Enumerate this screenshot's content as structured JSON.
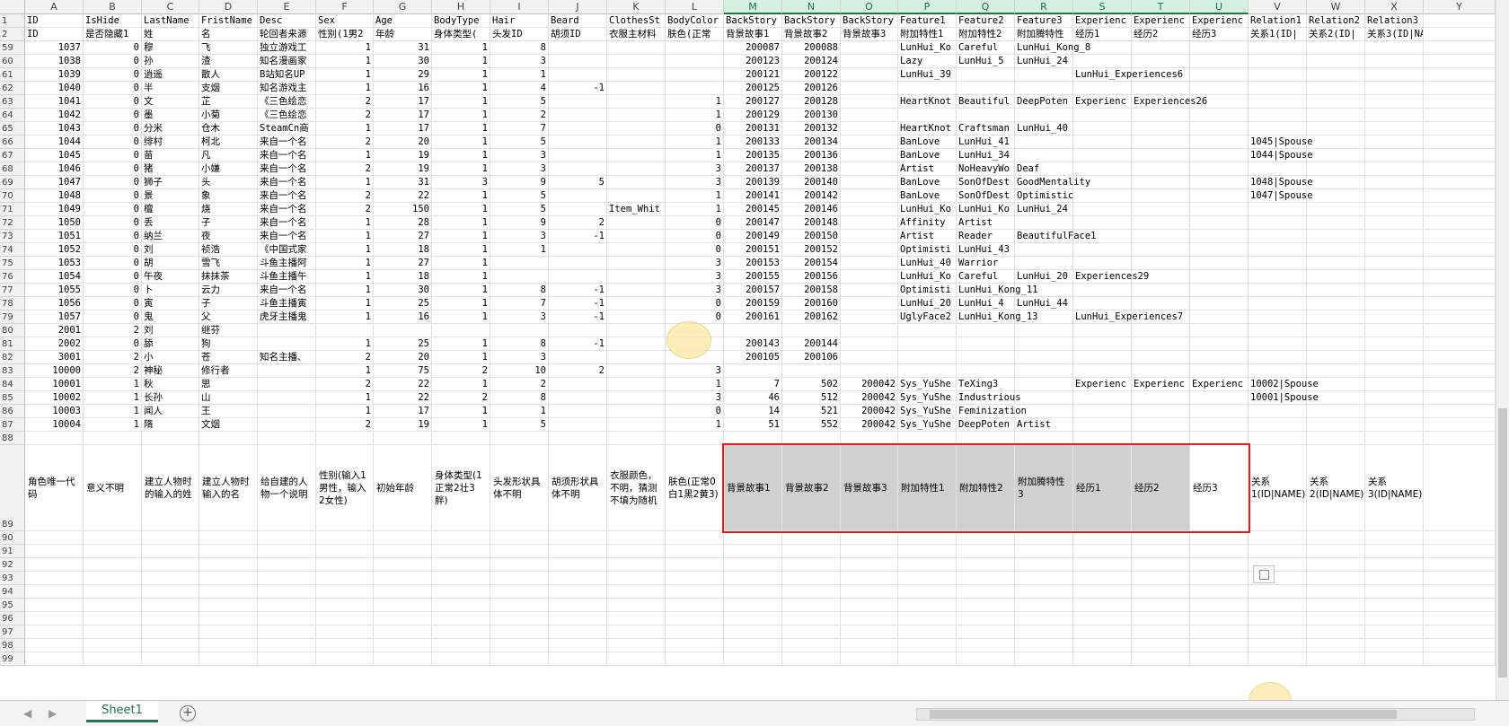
{
  "columns": [
    "A",
    "B",
    "C",
    "D",
    "E",
    "F",
    "G",
    "H",
    "I",
    "J",
    "K",
    "L",
    "M",
    "N",
    "O",
    "P",
    "Q",
    "R",
    "S",
    "T",
    "U",
    "V",
    "W",
    "X",
    "Y"
  ],
  "selected_columns": [
    "M",
    "N",
    "O",
    "P",
    "Q",
    "R",
    "S",
    "T",
    "U"
  ],
  "header_rows": [
    {
      "num": "1",
      "cells": [
        "ID",
        "IsHide",
        "LastName",
        "FristName",
        "Desc",
        "Sex",
        "Age",
        "BodyType",
        "Hair",
        "Beard",
        "ClothesSt",
        "BodyColor",
        "BackStory",
        "BackStory",
        "BackStory",
        "Feature1",
        "Feature2",
        "Feature3",
        "Experienc",
        "Experienc",
        "Experienc",
        "Relation1",
        "Relation2",
        "Relation3",
        ""
      ]
    },
    {
      "num": "2",
      "cells": [
        "ID",
        "是否隐藏1",
        "姓",
        "名",
        "轮回者来源",
        "性别(1男2",
        "年龄",
        "身体类型(",
        "头发ID",
        "胡须ID",
        "衣服主材料",
        "肤色(正常",
        "背景故事1",
        "背景故事2",
        "背景故事3",
        "附加特性1",
        "附加特性2",
        "附加腾特性",
        "经历1",
        "经历2",
        "经历3",
        "关系1(ID|",
        "关系2(ID|",
        "关系3(ID|NAME)",
        ""
      ]
    }
  ],
  "rows": [
    {
      "num": "59",
      "cells": [
        "1037",
        "0",
        "穆",
        "飞",
        "独立游戏工",
        "1",
        "31",
        "1",
        "8",
        "",
        "",
        "",
        "200087",
        "200088",
        "",
        "LunHui_Ko",
        "Careful",
        "LunHui_Kong_8",
        "",
        "",
        "",
        "",
        "",
        "",
        ""
      ]
    },
    {
      "num": "60",
      "cells": [
        "1038",
        "0",
        "孙",
        "渣",
        "知名漫画家",
        "1",
        "30",
        "1",
        "3",
        "",
        "",
        "",
        "200123",
        "200124",
        "",
        "Lazy",
        "LunHui_5",
        "LunHui_24",
        "",
        "",
        "",
        "",
        "",
        "",
        ""
      ]
    },
    {
      "num": "61",
      "cells": [
        "1039",
        "0",
        "逍遥",
        "散人",
        "B站知名UP",
        "1",
        "29",
        "1",
        "1",
        "",
        "",
        "",
        "200121",
        "200122",
        "",
        "LunHui_39",
        "",
        "",
        "LunHui_Experiences6",
        "",
        "",
        "",
        "",
        "",
        ""
      ]
    },
    {
      "num": "62",
      "cells": [
        "1040",
        "0",
        "半",
        "支烟",
        "知名游戏主",
        "1",
        "16",
        "1",
        "4",
        "-1",
        "",
        "",
        "200125",
        "200126",
        "",
        "",
        "",
        "",
        "",
        "",
        "",
        "",
        "",
        "",
        ""
      ]
    },
    {
      "num": "63",
      "cells": [
        "1041",
        "0",
        "文",
        "芷",
        "《三色绘恋",
        "2",
        "17",
        "1",
        "5",
        "",
        "",
        "1",
        "200127",
        "200128",
        "",
        "HeartKnot",
        "Beautiful",
        "DeepPoten",
        "Experienc",
        "Experiences26",
        "",
        "",
        "",
        "",
        ""
      ]
    },
    {
      "num": "64",
      "cells": [
        "1042",
        "0",
        "墨",
        "小菊",
        "《三色绘恋",
        "2",
        "17",
        "1",
        "2",
        "",
        "",
        "1",
        "200129",
        "200130",
        "",
        "",
        "",
        "",
        "",
        "",
        "",
        "",
        "",
        "",
        ""
      ]
    },
    {
      "num": "65",
      "cells": [
        "1043",
        "0",
        "分米",
        "仓木",
        "SteamCn商",
        "1",
        "17",
        "1",
        "7",
        "",
        "",
        "0",
        "200131",
        "200132",
        "",
        "HeartKnot",
        "Craftsman",
        "LunHui_40",
        "",
        "",
        "",
        "",
        "",
        "",
        ""
      ]
    },
    {
      "num": "66",
      "cells": [
        "1044",
        "0",
        "绯村",
        "柯北",
        "来自一个名",
        "2",
        "20",
        "1",
        "5",
        "",
        "",
        "1",
        "200133",
        "200134",
        "",
        "BanLove",
        "LunHui_41",
        "",
        "",
        "",
        "",
        "1045|Spouse",
        "",
        "",
        ""
      ]
    },
    {
      "num": "67",
      "cells": [
        "1045",
        "0",
        "苗",
        "凡",
        "来自一个名",
        "1",
        "19",
        "1",
        "3",
        "",
        "",
        "1",
        "200135",
        "200136",
        "",
        "BanLove",
        "LunHui_34",
        "",
        "",
        "",
        "",
        "1044|Spouse",
        "",
        "",
        ""
      ]
    },
    {
      "num": "68",
      "cells": [
        "1046",
        "0",
        "猪",
        "小嫌",
        "来自一个名",
        "2",
        "19",
        "1",
        "3",
        "",
        "",
        "3",
        "200137",
        "200138",
        "",
        "Artist",
        "NoHeavyWo",
        "Deaf",
        "",
        "",
        "",
        "",
        "",
        "",
        ""
      ]
    },
    {
      "num": "69",
      "cells": [
        "1047",
        "0",
        "狮子",
        "头",
        "来自一个名",
        "1",
        "31",
        "3",
        "9",
        "5",
        "",
        "3",
        "200139",
        "200140",
        "",
        "BanLove",
        "SonOfDest",
        "GoodMentality",
        "",
        "",
        "",
        "1048|Spouse",
        "",
        "",
        ""
      ]
    },
    {
      "num": "70",
      "cells": [
        "1048",
        "0",
        "景",
        "象",
        "来自一个名",
        "2",
        "22",
        "1",
        "5",
        "",
        "",
        "1",
        "200141",
        "200142",
        "",
        "BanLove",
        "SonOfDest",
        "Optimistic",
        "",
        "",
        "",
        "1047|Spouse",
        "",
        "",
        ""
      ]
    },
    {
      "num": "71",
      "cells": [
        "1049",
        "0",
        "檀",
        "烧",
        "来自一个名",
        "2",
        "150",
        "1",
        "5",
        "",
        "Item_Whit",
        "1",
        "200145",
        "200146",
        "",
        "LunHui_Ko",
        "LunHui_Ko",
        "LunHui_24",
        "",
        "",
        "",
        "",
        "",
        "",
        ""
      ]
    },
    {
      "num": "72",
      "cells": [
        "1050",
        "0",
        "丢",
        "子",
        "来自一个名",
        "1",
        "28",
        "1",
        "9",
        "2",
        "",
        "0",
        "200147",
        "200148",
        "",
        "Affinity",
        "Artist",
        "",
        "",
        "",
        "",
        "",
        "",
        "",
        ""
      ]
    },
    {
      "num": "73",
      "cells": [
        "1051",
        "0",
        "纳兰",
        "夜",
        "来自一个名",
        "1",
        "27",
        "1",
        "3",
        "-1",
        "",
        "0",
        "200149",
        "200150",
        "",
        "Artist",
        "Reader",
        "BeautifulFace1",
        "",
        "",
        "",
        "",
        "",
        "",
        ""
      ]
    },
    {
      "num": "74",
      "cells": [
        "1052",
        "0",
        "刘",
        "祯浩",
        "《中国式家",
        "1",
        "18",
        "1",
        "1",
        "",
        "",
        "0",
        "200151",
        "200152",
        "",
        "Optimisti",
        "LunHui_43",
        "",
        "",
        "",
        "",
        "",
        "",
        "",
        ""
      ]
    },
    {
      "num": "75",
      "cells": [
        "1053",
        "0",
        "胡",
        "雪飞",
        "斗鱼主播阿",
        "1",
        "27",
        "1",
        "",
        "",
        "",
        "3",
        "200153",
        "200154",
        "",
        "LunHui_40",
        "Warrior",
        "",
        "",
        "",
        "",
        "",
        "",
        "",
        ""
      ]
    },
    {
      "num": "76",
      "cells": [
        "1054",
        "0",
        "午夜",
        "抹抹茶",
        "斗鱼主播午",
        "1",
        "18",
        "1",
        "",
        "",
        "",
        "3",
        "200155",
        "200156",
        "",
        "LunHui_Ko",
        "Careful",
        "LunHui_20",
        "Experiences29",
        "",
        "",
        "",
        "",
        "",
        ""
      ]
    },
    {
      "num": "77",
      "cells": [
        "1055",
        "0",
        "卜",
        "云力",
        "来自一个名",
        "1",
        "30",
        "1",
        "8",
        "-1",
        "",
        "3",
        "200157",
        "200158",
        "",
        "Optimisti",
        "LunHui_Kong_11",
        "",
        "",
        "",
        "",
        "",
        "",
        "",
        ""
      ]
    },
    {
      "num": "78",
      "cells": [
        "1056",
        "0",
        "寅",
        "子",
        "斗鱼主播寅",
        "1",
        "25",
        "1",
        "7",
        "-1",
        "",
        "0",
        "200159",
        "200160",
        "",
        "LunHui_20",
        "LunHui_4",
        "LunHui_44",
        "",
        "",
        "",
        "",
        "",
        "",
        ""
      ]
    },
    {
      "num": "79",
      "cells": [
        "1057",
        "0",
        "鬼",
        "父",
        "虎牙主播鬼",
        "1",
        "16",
        "1",
        "3",
        "-1",
        "",
        "0",
        "200161",
        "200162",
        "",
        "UglyFace2",
        "LunHui_Kong_13",
        "",
        "LunHui_Experiences7",
        "",
        "",
        "",
        "",
        "",
        ""
      ]
    },
    {
      "num": "80",
      "cells": [
        "2001",
        "2",
        "刘",
        "继芬",
        "",
        "",
        "",
        "",
        "",
        "",
        "",
        "",
        "",
        "",
        "",
        "",
        "",
        "",
        "",
        "",
        "",
        "",
        "",
        "",
        ""
      ]
    },
    {
      "num": "81",
      "cells": [
        "2002",
        "0",
        "舔",
        "狗",
        "",
        "1",
        "25",
        "1",
        "8",
        "-1",
        "",
        "",
        "200143",
        "200144",
        "",
        "",
        "",
        "",
        "",
        "",
        "",
        "",
        "",
        "",
        ""
      ]
    },
    {
      "num": "82",
      "cells": [
        "3001",
        "2",
        "小",
        "苍",
        "知名主播、",
        "2",
        "20",
        "1",
        "3",
        "",
        "",
        "",
        "200105",
        "200106",
        "",
        "",
        "",
        "",
        "",
        "",
        "",
        "",
        "",
        "",
        ""
      ]
    },
    {
      "num": "83",
      "cells": [
        "10000",
        "2",
        "神秘",
        "修行者",
        "",
        "1",
        "75",
        "2",
        "10",
        "2",
        "",
        "3",
        "",
        "",
        "",
        "",
        "",
        "",
        "",
        "",
        "",
        "",
        "",
        "",
        ""
      ]
    },
    {
      "num": "84",
      "cells": [
        "10001",
        "1",
        "秋",
        "思",
        "",
        "2",
        "22",
        "1",
        "2",
        "",
        "",
        "1",
        "7",
        "502",
        "200042",
        "Sys_YuShe",
        "TeXing3",
        "",
        "Experienc",
        "Experienc",
        "Experienc",
        "10002|Spouse",
        "",
        "",
        ""
      ]
    },
    {
      "num": "85",
      "cells": [
        "10002",
        "1",
        "长孙",
        "山",
        "",
        "1",
        "22",
        "2",
        "8",
        "",
        "",
        "3",
        "46",
        "512",
        "200042",
        "Sys_YuShe",
        "Industrious",
        "",
        "",
        "",
        "",
        "10001|Spouse",
        "",
        "",
        ""
      ]
    },
    {
      "num": "86",
      "cells": [
        "10003",
        "1",
        "闻人",
        "王",
        "",
        "1",
        "17",
        "1",
        "1",
        "",
        "",
        "0",
        "14",
        "521",
        "200042",
        "Sys_YuShe",
        "Feminization",
        "",
        "",
        "",
        "",
        "",
        "",
        "",
        ""
      ]
    },
    {
      "num": "87",
      "cells": [
        "10004",
        "1",
        "隋",
        "文烟",
        "",
        "2",
        "19",
        "1",
        "5",
        "",
        "",
        "1",
        "51",
        "552",
        "200042",
        "Sys_YuShe",
        "DeepPoten",
        "Artist",
        "",
        "",
        "",
        "",
        "",
        "",
        ""
      ]
    },
    {
      "num": "88",
      "cells": [
        "",
        "",
        "",
        "",
        "",
        "",
        "",
        "",
        "",
        "",
        "",
        "",
        "",
        "",
        "",
        "",
        "",
        "",
        "",
        "",
        "",
        "",
        "",
        "",
        ""
      ]
    }
  ],
  "notes_row": {
    "num": "89",
    "cells": [
      "角色唯一代码",
      "意义不明",
      "建立人物时的输入的姓",
      "建立人物时输入的名",
      "给自建的人物一个说明",
      "性别(输入1男性，输入2女性)",
      "初始年龄",
      "身体类型(1正常2壮3胖)",
      "头发形状具体不明",
      "胡须形状具体不明",
      "衣服颜色，不明，猜测不填为随机",
      "肤色(正常0白1黑2黄3)",
      "背景故事1",
      "背景故事2",
      "背景故事3",
      "附加特性1",
      "附加特性2",
      "附加腾特性3",
      "经历1",
      "经历2",
      "经历3",
      "关系1(ID|NAME)",
      "关系2(ID|NAME)",
      "关系3(ID|NAME)",
      ""
    ]
  },
  "empty_rows": [
    "90",
    "91",
    "92",
    "93",
    "94",
    "95",
    "96",
    "97",
    "98",
    "99"
  ],
  "sheet_tab": "Sheet1",
  "add_sheet": "+",
  "nav_prev": "◀",
  "nav_next": "▶",
  "colors": {
    "highlight_border": "#e02020",
    "gray_fill": "#d0d0d0",
    "selected_header": "#217346"
  }
}
